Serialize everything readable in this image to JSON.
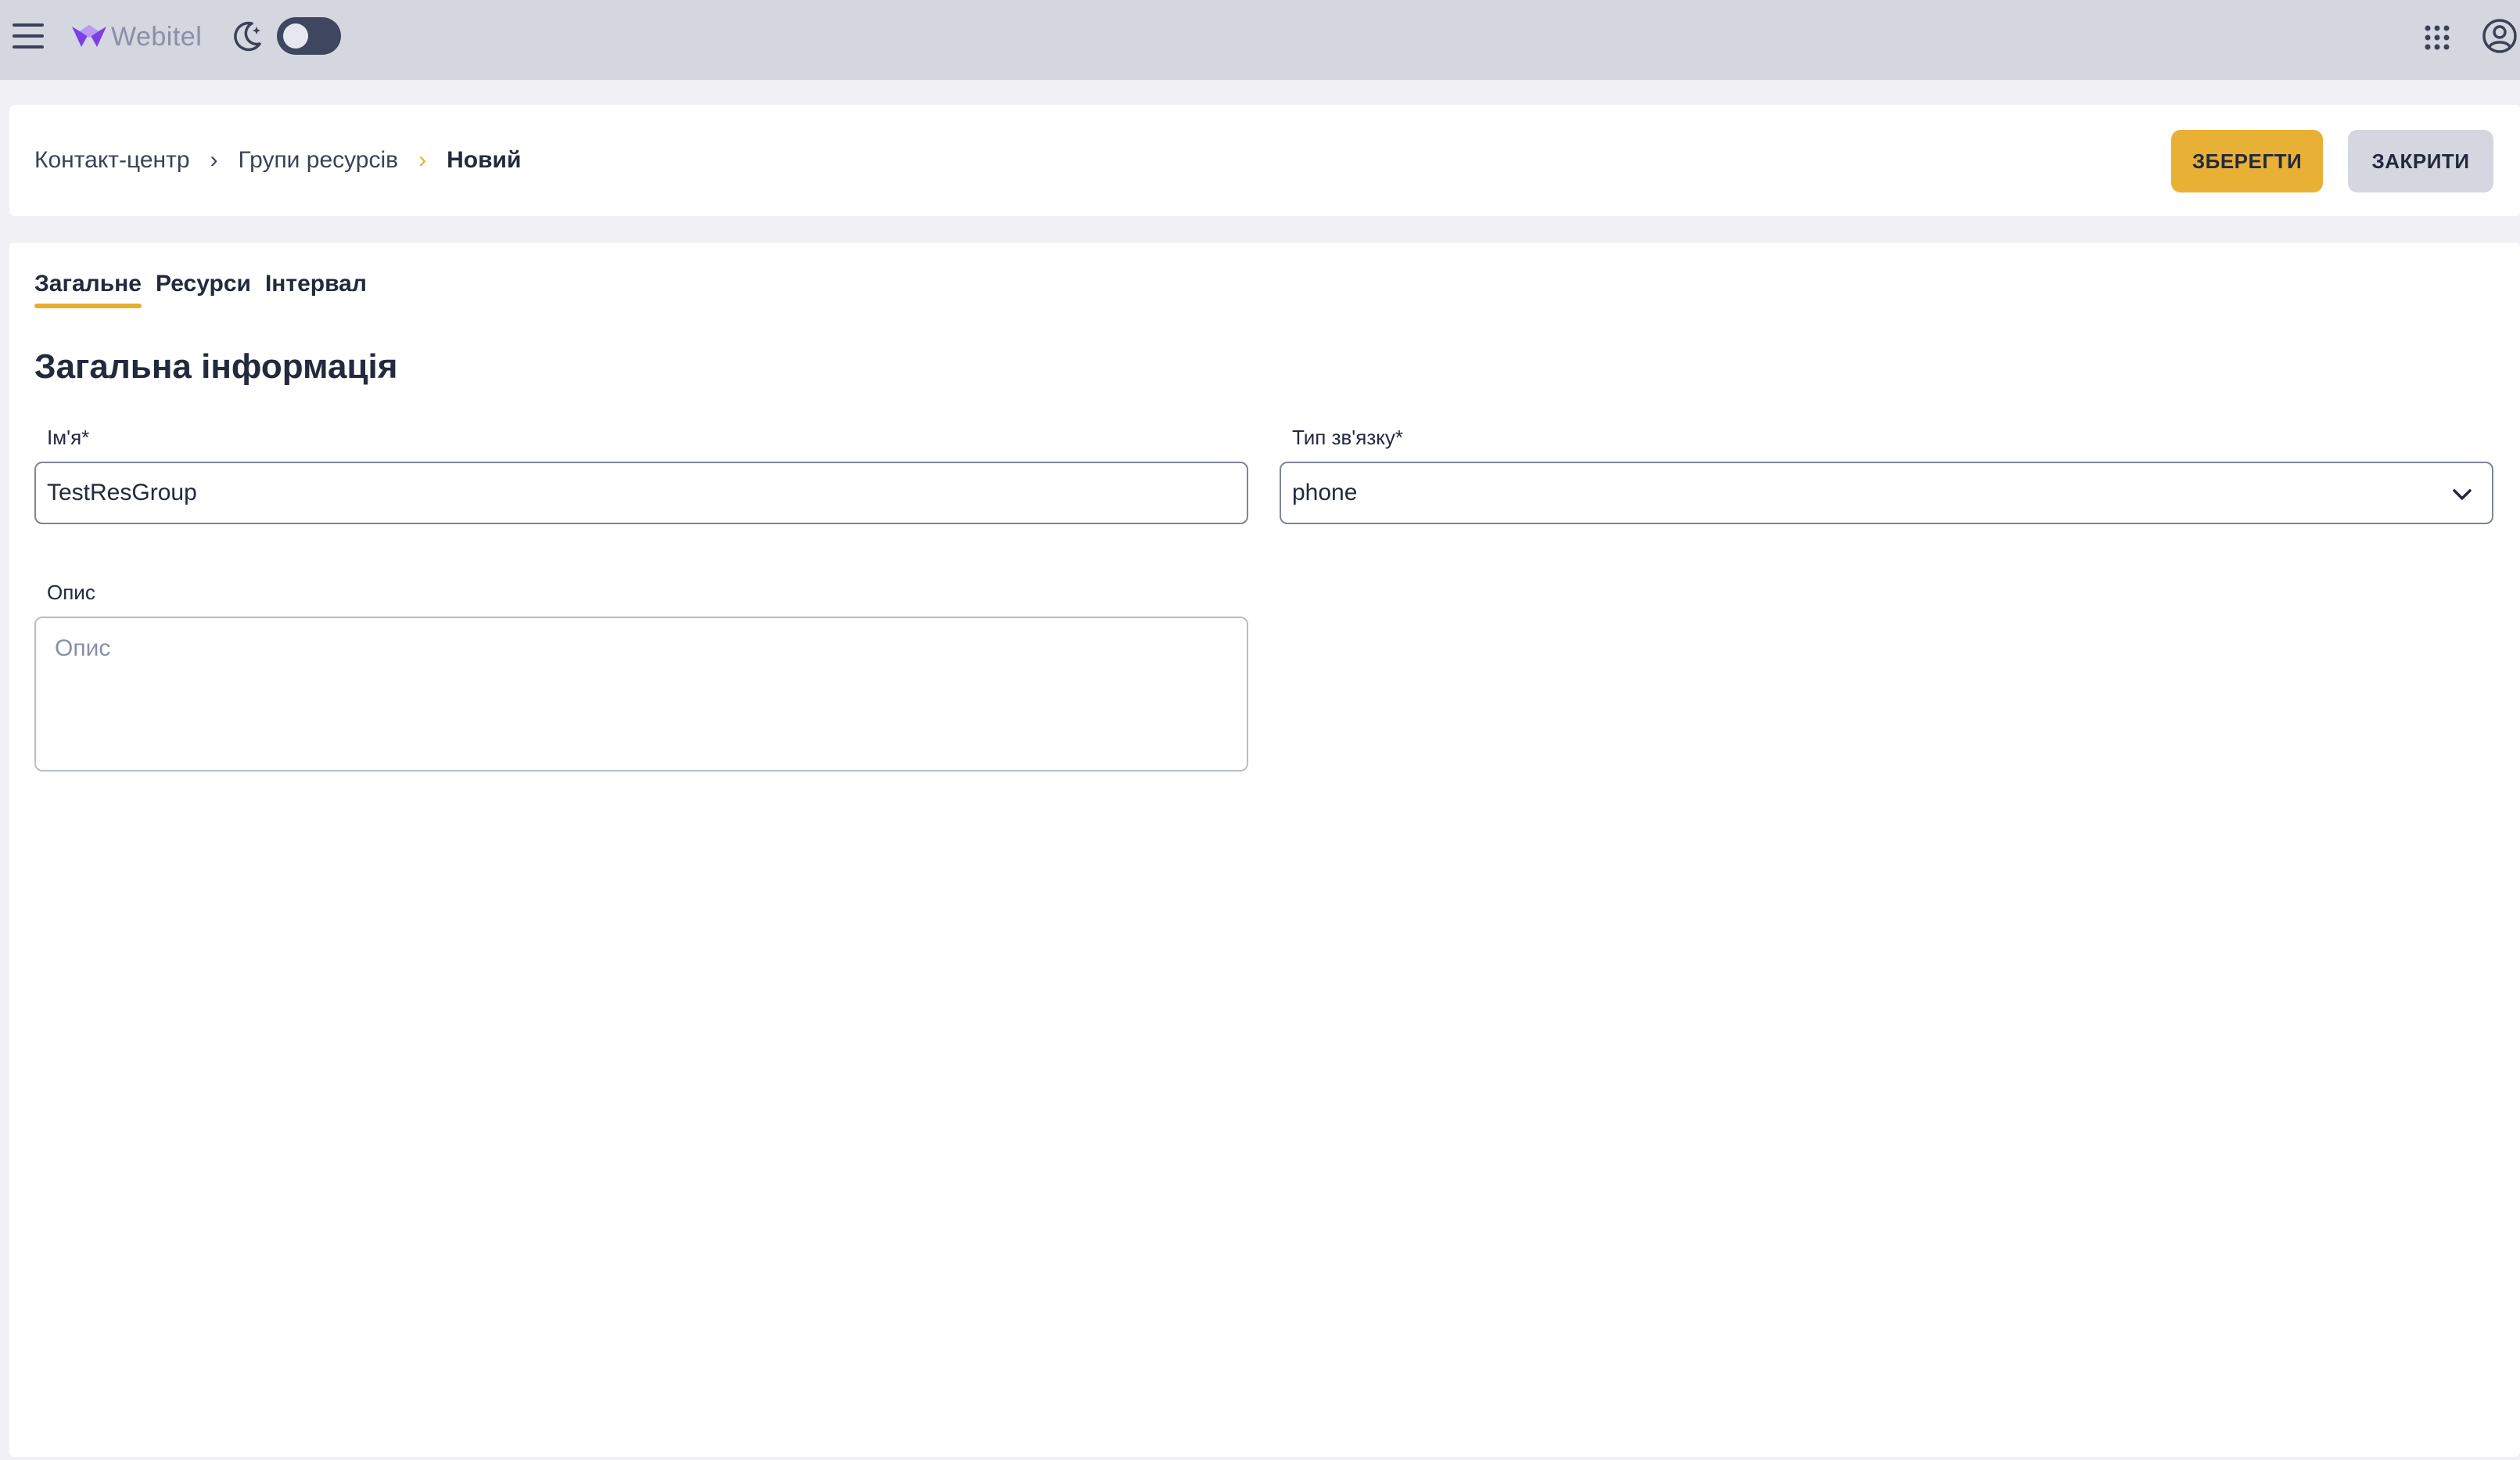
{
  "app": {
    "logo_text": "Webitel",
    "theme_toggle_on": false
  },
  "header": {
    "breadcrumb": [
      "Контакт-центр",
      "Групи ресурсів",
      "Новий"
    ],
    "save_label": "ЗБЕРЕГТИ",
    "close_label": "ЗАКРИТИ"
  },
  "tabs": [
    {
      "label": "Загальне",
      "active": true
    },
    {
      "label": "Ресурси",
      "active": false
    },
    {
      "label": "Інтервал",
      "active": false
    }
  ],
  "section": {
    "title": "Загальна інформація"
  },
  "form": {
    "name_label": "Ім'я*",
    "name_value": "TestResGroup",
    "comm_type_label": "Тип зв'язку*",
    "comm_type_value": "phone",
    "description_label": "Опис",
    "description_placeholder": "Опис",
    "description_value": ""
  },
  "colors": {
    "accent": "#e8ad2c",
    "save_button": "#e8b035",
    "appbar": "#d4d6e0",
    "logo_mark": "#7b3fe4"
  },
  "icons": [
    "menu-icon",
    "webitel-logo-icon",
    "moon-icon",
    "apps-grid-icon",
    "user-account-icon",
    "chevron-down-icon"
  ]
}
